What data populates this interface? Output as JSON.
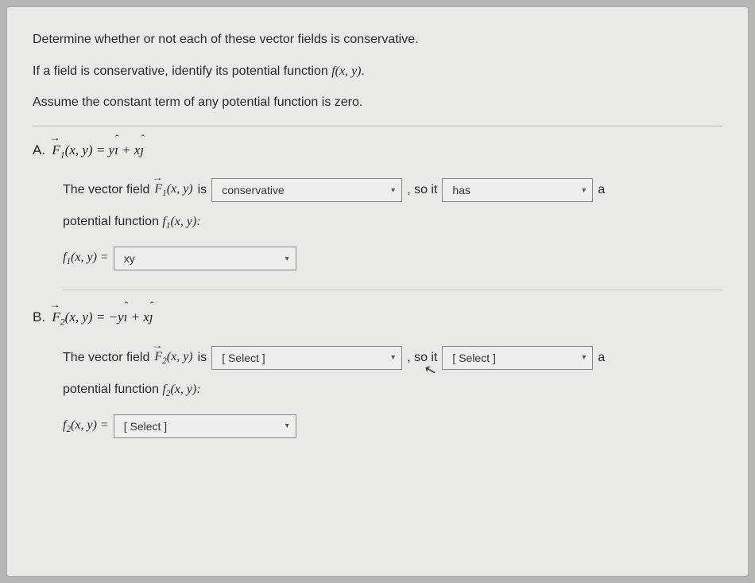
{
  "intro": {
    "p1": "Determine whether or not each of these vector fields is conservative.",
    "p2_pre": "If a field is conservative, identify its potential function ",
    "p2_fn": "f(x, y)",
    "p2_post": ".",
    "p3": "Assume the constant term of any potential function is zero."
  },
  "partA": {
    "letter": "A.",
    "lhs_var": "F",
    "lhs_sub": "1",
    "lhs_args": "(x, y) = y",
    "ihat": "ı",
    "plus": " + x",
    "jhat": "ȷ",
    "sent_pre": "The vector field ",
    "sent_var": "F",
    "sent_sub": "1",
    "sent_args": "(x, y)",
    "sent_is": " is",
    "select1": "conservative",
    "soit": ", so it",
    "select2": "has",
    "trail": "a",
    "potline": "potential function ",
    "pot_var": "f",
    "pot_sub": "1",
    "pot_args": "(x, y):",
    "eq_var": "f",
    "eq_sub": "1",
    "eq_args": "(x, y) =",
    "select3": "xy"
  },
  "partB": {
    "letter": "B.",
    "lhs_var": "F",
    "lhs_sub": "2",
    "lhs_args": "(x, y) = −y",
    "ihat": "ı",
    "plus": " + x",
    "jhat": "ȷ",
    "sent_pre": "The vector field ",
    "sent_var": "F",
    "sent_sub": "2",
    "sent_args": "(x, y)",
    "sent_is": " is",
    "select1": "[ Select ]",
    "soit": ", so it",
    "select2": "[ Select ]",
    "trail": "a",
    "potline": "potential function ",
    "pot_var": "f",
    "pot_sub": "2",
    "pot_args": "(x, y):",
    "eq_var": "f",
    "eq_sub": "2",
    "eq_args": "(x, y) =",
    "select3": "[ Select ]"
  }
}
